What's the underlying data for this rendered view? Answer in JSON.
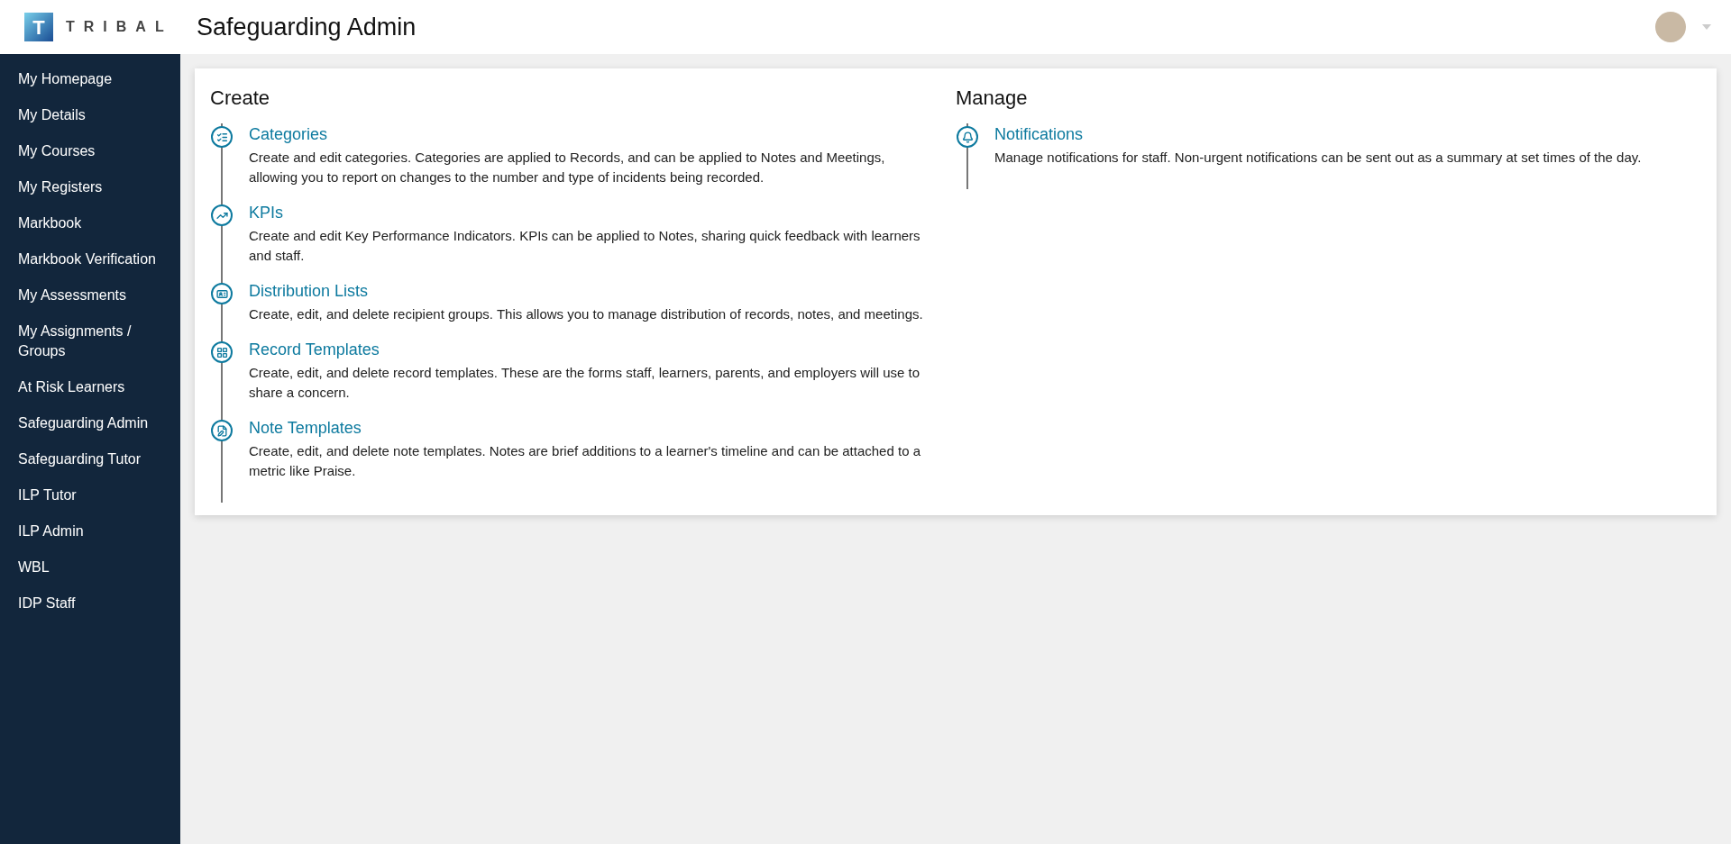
{
  "header": {
    "logo_letter": "T",
    "logo_text": "TRIBAL",
    "title": "Safeguarding Admin"
  },
  "sidebar": {
    "items": [
      {
        "label": "My Homepage"
      },
      {
        "label": "My Details"
      },
      {
        "label": "My Courses"
      },
      {
        "label": "My Registers"
      },
      {
        "label": "Markbook"
      },
      {
        "label": "Markbook Verification"
      },
      {
        "label": "My Assessments"
      },
      {
        "label": "My Assignments / Groups"
      },
      {
        "label": "At Risk Learners"
      },
      {
        "label": "Safeguarding Admin"
      },
      {
        "label": "Safeguarding Tutor"
      },
      {
        "label": "ILP Tutor"
      },
      {
        "label": "ILP Admin"
      },
      {
        "label": "WBL"
      },
      {
        "label": "IDP Staff"
      }
    ]
  },
  "sections": [
    {
      "heading": "Create",
      "items": [
        {
          "title": "Categories",
          "description": "Create and edit categories. Categories are applied to Records, and can be applied to Notes and Meetings, allowing you to report on changes to the number and type of incidents being recorded."
        },
        {
          "title": "KPIs",
          "description": "Create and edit Key Performance Indicators. KPIs can be applied to Notes, sharing quick feedback with learners and staff."
        },
        {
          "title": "Distribution Lists",
          "description": "Create, edit, and delete recipient groups. This allows you to manage distribution of records, notes, and meetings."
        },
        {
          "title": "Record Templates",
          "description": "Create, edit, and delete record templates. These are the forms staff, learners, parents, and employers will use to share a concern."
        },
        {
          "title": "Note Templates",
          "description": "Create, edit, and delete note templates. Notes are brief additions to a learner's timeline and can be attached to a metric like Praise."
        }
      ]
    },
    {
      "heading": "Manage",
      "items": [
        {
          "title": "Notifications",
          "description": "Manage notifications for staff. Non-urgent notifications can be sent out as a summary at set times of the day."
        }
      ]
    }
  ]
}
